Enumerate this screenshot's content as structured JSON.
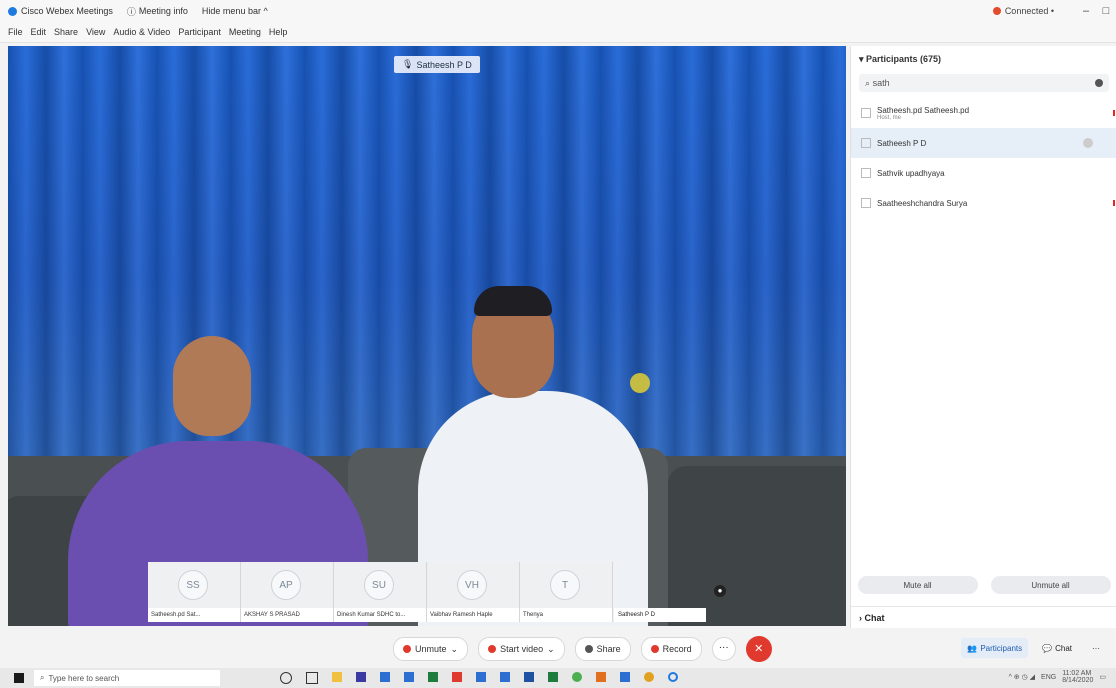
{
  "titlebar": {
    "app_title": "Cisco Webex Meetings",
    "meeting_info": "Meeting info",
    "hide_menu": "Hide menu bar ^",
    "connection": "Connected •",
    "minimize": "–",
    "restore": "□"
  },
  "menu": [
    "File",
    "Edit",
    "Share",
    "View",
    "Audio & Video",
    "Participant",
    "Meeting",
    "Help"
  ],
  "video": {
    "speaker_label": "Satheesh P D"
  },
  "thumbnails": [
    {
      "initials": "SS",
      "caption": "Satheesh.pd Sat..."
    },
    {
      "initials": "AP",
      "caption": "AKSHAY S PRASAD"
    },
    {
      "initials": "SU",
      "caption": "Dinesh Kumar SDHC to..."
    },
    {
      "initials": "VH",
      "caption": "Vaibhav Ramesh Haple"
    },
    {
      "initials": "T",
      "caption": "Thenya"
    }
  ],
  "thumb_last_caption": "Satheesh P D",
  "panel": {
    "title": "Participants (675)",
    "search_value": "sath",
    "participants": [
      {
        "name": "Satheesh.pd Satheesh.pd",
        "sub": "Host, me"
      },
      {
        "name": "Satheesh P D",
        "sub": ""
      },
      {
        "name": "Sathvik upadhyaya",
        "sub": ""
      },
      {
        "name": "Saatheeshchandra Surya",
        "sub": ""
      }
    ],
    "mute_all": "Mute all",
    "unmute_all": "Unmute all",
    "chat_label": "Chat"
  },
  "controls": {
    "unmute": "Unmute",
    "start_video": "Start video",
    "share": "Share",
    "record": "Record",
    "more": "···",
    "end": "✕",
    "participants": "Participants",
    "chat": "Chat"
  },
  "taskbar": {
    "search_placeholder": "Type here to search",
    "lang": "ENG",
    "time": "11:02 AM",
    "date": "8/14/2020"
  }
}
